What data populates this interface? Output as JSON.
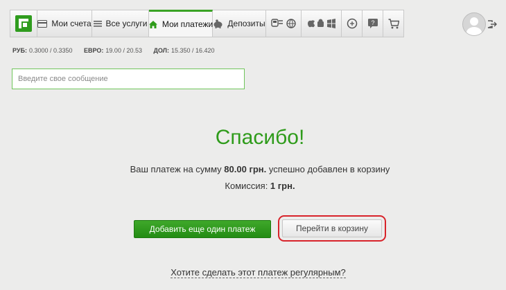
{
  "nav": {
    "tabs": [
      {
        "label": "Мои счета",
        "icon": "card-icon"
      },
      {
        "label": "Все услуги",
        "icon": "list-icon"
      },
      {
        "label": "Мои платежи",
        "icon": "home-icon"
      },
      {
        "label": "Депозиты",
        "icon": "piggy-bank-icon"
      }
    ],
    "icon_tabs": [
      "transport-icon",
      "globe-icon",
      "apple-android-windows-icon",
      "coin-icon",
      "help-icon",
      "cart-icon"
    ]
  },
  "rates": [
    {
      "name": "РУБ:",
      "value": "0.3000 / 0.3350"
    },
    {
      "name": "ЕВРО:",
      "value": "19.00 / 20.53"
    },
    {
      "name": "ДОЛ:",
      "value": "15.350 / 16.420"
    }
  ],
  "message": {
    "placeholder": "Введите свое сообщение",
    "value": ""
  },
  "result": {
    "title": "Спасибо!",
    "line1_prefix": "Ваш платеж на сумму ",
    "amount": "80.00 грн.",
    "line1_suffix": " успешно добавлен в корзину",
    "fee_prefix": "Комиссия: ",
    "fee": "1 грн."
  },
  "buttons": {
    "add_another": "Добавить еще один платеж",
    "go_to_cart": "Перейти в корзину"
  },
  "regular_link": "Хотите сделать этот платеж регулярным?",
  "colors": {
    "accent_green": "#2e9b1a",
    "highlight_red": "#d8232a"
  }
}
